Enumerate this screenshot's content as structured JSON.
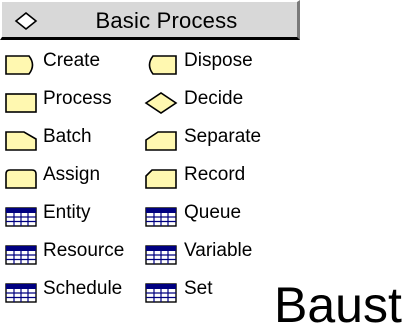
{
  "panel": {
    "title": "Basic Process",
    "header_icon": "diamond-icon",
    "colors": {
      "module_fill": "#fff8b0",
      "table_header": "#000080",
      "header_bg": "#d8d8d8"
    },
    "modules": [
      {
        "label": "Create",
        "icon": "create-module-icon"
      },
      {
        "label": "Dispose",
        "icon": "dispose-module-icon"
      },
      {
        "label": "Process",
        "icon": "process-module-icon"
      },
      {
        "label": "Decide",
        "icon": "decide-module-icon"
      },
      {
        "label": "Batch",
        "icon": "batch-module-icon"
      },
      {
        "label": "Separate",
        "icon": "separate-module-icon"
      },
      {
        "label": "Assign",
        "icon": "assign-module-icon"
      },
      {
        "label": "Record",
        "icon": "record-module-icon"
      }
    ],
    "data_modules": [
      {
        "label": "Entity",
        "icon": "spreadsheet-icon"
      },
      {
        "label": "Queue",
        "icon": "spreadsheet-icon"
      },
      {
        "label": "Resource",
        "icon": "spreadsheet-icon"
      },
      {
        "label": "Variable",
        "icon": "spreadsheet-icon"
      },
      {
        "label": "Schedule",
        "icon": "spreadsheet-icon"
      },
      {
        "label": "Set",
        "icon": "spreadsheet-icon"
      }
    ]
  },
  "overflow_text": "Baust"
}
